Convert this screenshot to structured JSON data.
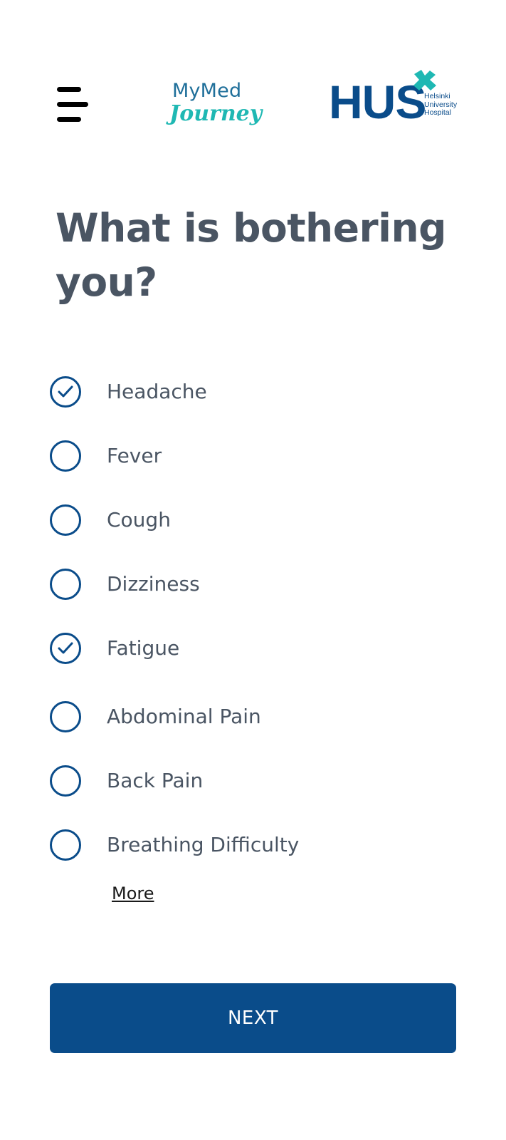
{
  "header": {
    "logo_mymed_top": "MyMed",
    "logo_mymed_bottom": "Journey",
    "logo_hus": "HUS",
    "logo_hus_sub": [
      "Helsinki",
      "University",
      "Hospital"
    ],
    "hamburger_icon": "hamburger-menu-icon"
  },
  "main": {
    "title": "What is bothering you?",
    "options": [
      {
        "label": "Headache",
        "checked": true
      },
      {
        "label": "Fever",
        "checked": false
      },
      {
        "label": "Cough",
        "checked": false
      },
      {
        "label": "Dizziness",
        "checked": false
      },
      {
        "label": "Fatigue",
        "checked": true
      },
      {
        "label": "Abdominal Pain",
        "checked": false
      },
      {
        "label": "Back Pain",
        "checked": false
      },
      {
        "label": "Breathing Difficulty",
        "checked": false
      }
    ],
    "more_label": "More",
    "next_label": "NEXT"
  },
  "colors": {
    "primary": "#0a4c8a",
    "teal": "#1fb8b3",
    "text": "#4a5563",
    "background": "#ffffff"
  }
}
